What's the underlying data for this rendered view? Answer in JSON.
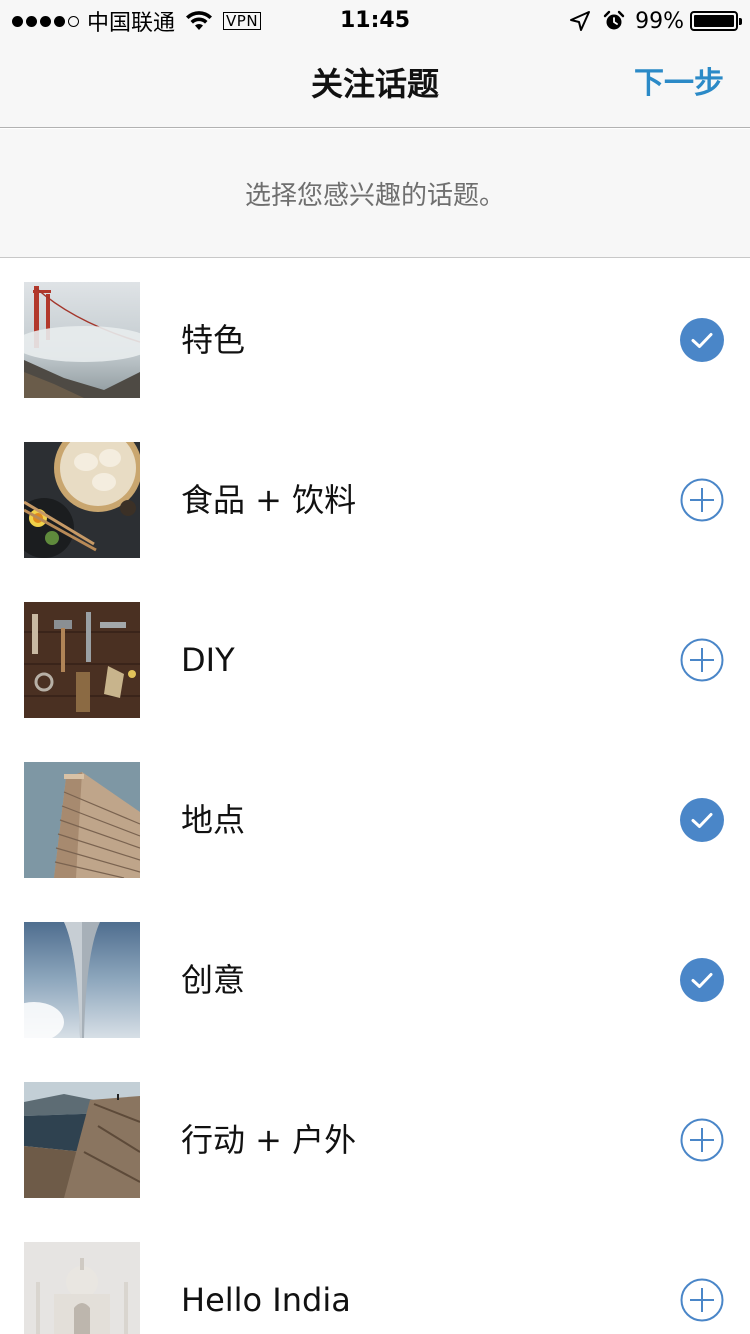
{
  "status_bar": {
    "carrier": "中国联通",
    "vpn": "VPN",
    "time": "11:45",
    "battery": "99%",
    "battery_level": 0.99
  },
  "nav": {
    "title": "关注话题",
    "next_label": "下一步"
  },
  "subtitle": "选择您感兴趣的话题。",
  "colors": {
    "accent": "#2b8ac7",
    "selected": "#4a86c8",
    "unselected": "#4a86c8"
  },
  "topics": [
    {
      "label": "特色",
      "selected": true,
      "thumb": "golden-gate-bridge-fog"
    },
    {
      "label": "食品 + 饮料",
      "selected": false,
      "thumb": "dumplings-food"
    },
    {
      "label": "DIY",
      "selected": false,
      "thumb": "workbench-tools"
    },
    {
      "label": "地点",
      "selected": true,
      "thumb": "flatiron-building"
    },
    {
      "label": "创意",
      "selected": true,
      "thumb": "tower-sky"
    },
    {
      "label": "行动 + 户外",
      "selected": false,
      "thumb": "cliff-fjord"
    },
    {
      "label": "Hello India",
      "selected": false,
      "thumb": "taj-mahal"
    }
  ]
}
